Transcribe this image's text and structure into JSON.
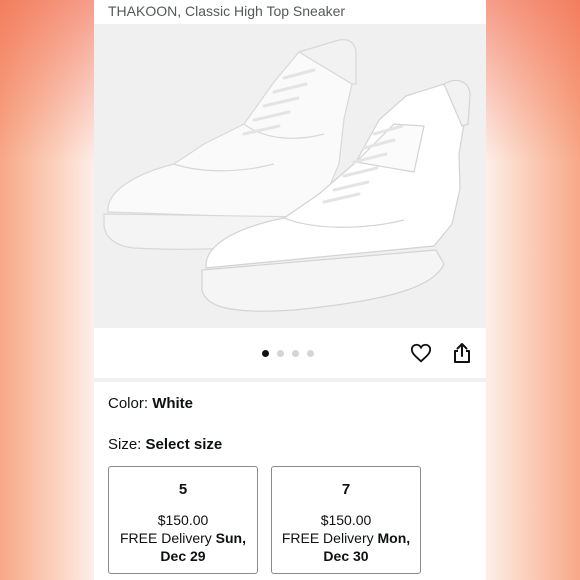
{
  "product": {
    "title": "THAKOON, Classic High Top Sneaker"
  },
  "carousel": {
    "dot_count": 4,
    "active_index": 0
  },
  "color": {
    "label": "Color: ",
    "value": "White"
  },
  "size": {
    "label": "Size: ",
    "value": "Select size"
  },
  "size_options": [
    {
      "size": "5",
      "price": "$150.00",
      "delivery_prefix": "FREE Delivery ",
      "delivery_date": "Sun, Dec 29"
    },
    {
      "size": "7",
      "price": "$150.00",
      "delivery_prefix": "FREE Delivery ",
      "delivery_date": "Mon, Dec 30"
    }
  ],
  "icons": {
    "wishlist": "heart-icon",
    "share": "share-icon"
  },
  "colors": {
    "text_primary": "#0f1111",
    "text_secondary": "#565959",
    "card_border": "#888c8c",
    "image_background": "#f0f0f0"
  }
}
